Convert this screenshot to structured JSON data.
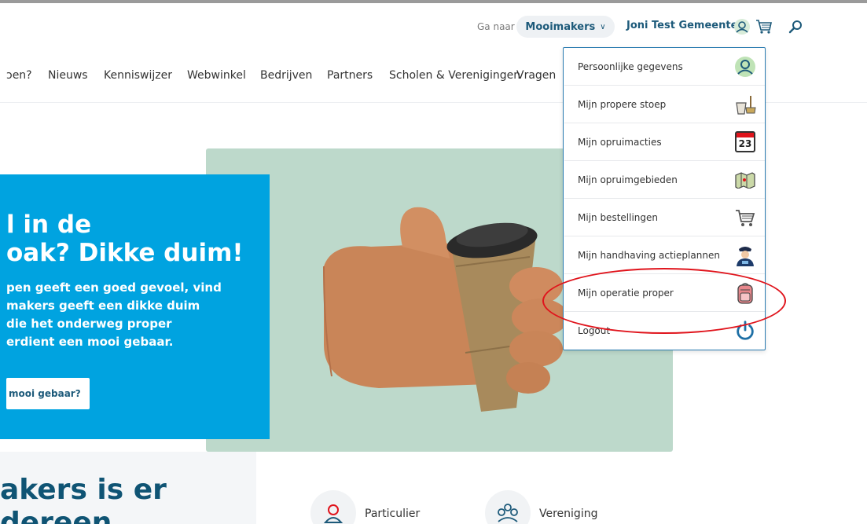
{
  "header": {
    "goto_label": "Ga naar",
    "site_dropdown": "Mooimakers",
    "user_name": "Joni Test Gemeente",
    "icons": [
      "user-icon",
      "cart-icon",
      "search-icon"
    ]
  },
  "nav": {
    "items": [
      "ɔen?",
      "Nieuws",
      "Kenniswijzer",
      "Webwinkel",
      "Bedrijven",
      "Partners",
      "Scholen & Verenigingen",
      "Vragen"
    ]
  },
  "hero": {
    "title_line1": "l in de",
    "title_line2": "oak? Dikke duim!",
    "body_line1": "pen geeft een goed gevoel, vind",
    "body_line2": "makers geeft een dikke duim",
    "body_line3": "die het onderweg proper",
    "body_line4": "erdient een mooi gebaar.",
    "button_label": "mooi gebaar?"
  },
  "lower": {
    "title_line1": "akers is er",
    "title_line2": "dereen",
    "categories": [
      "Particulier",
      "Vereniging"
    ]
  },
  "account_menu": {
    "items": [
      {
        "label": "Persoonlijke gegevens",
        "icon": "user-avatar-icon"
      },
      {
        "label": "Mijn propere stoep",
        "icon": "bucket-broom-icon"
      },
      {
        "label": "Mijn opruimacties",
        "icon": "calendar-icon",
        "icon_text": "23"
      },
      {
        "label": "Mijn opruimgebieden",
        "icon": "map-icon"
      },
      {
        "label": "Mijn bestellingen",
        "icon": "cart-icon"
      },
      {
        "label": "Mijn handhaving actieplannen",
        "icon": "officer-icon"
      },
      {
        "label": "Mijn operatie proper",
        "icon": "backpack-icon"
      },
      {
        "label": "Logout",
        "icon": "power-icon"
      }
    ]
  },
  "colors": {
    "brand_blue": "#00a3e0",
    "dark_teal": "#1d5a7a",
    "hero_green": "#bdd9cb",
    "highlight_red": "#e0141c"
  }
}
